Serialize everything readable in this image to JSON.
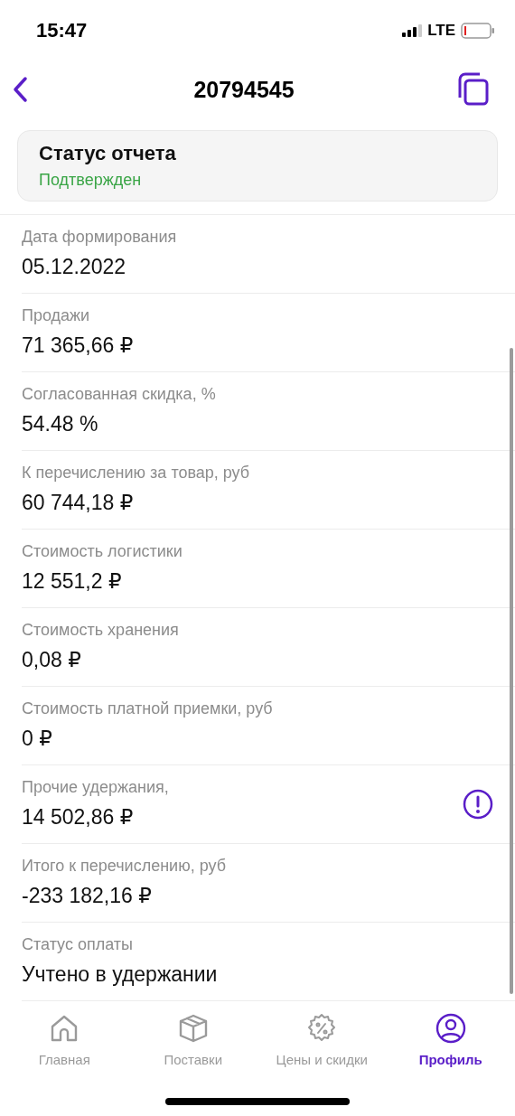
{
  "status_bar": {
    "time": "15:47",
    "network": "LTE"
  },
  "header": {
    "title": "20794545"
  },
  "status_card": {
    "title": "Статус отчета",
    "value": "Подтвержден"
  },
  "rows": [
    {
      "label": "Дата формирования",
      "value": "05.12.2022",
      "alert": false
    },
    {
      "label": "Продажи",
      "value": "71 365,66 ₽",
      "alert": false
    },
    {
      "label": "Согласованная скидка, %",
      "value": "54.48 %",
      "alert": false
    },
    {
      "label": "К перечислению за товар, руб",
      "value": "60 744,18 ₽",
      "alert": false
    },
    {
      "label": "Стоимость логистики",
      "value": "12 551,2 ₽",
      "alert": false
    },
    {
      "label": "Стоимость хранения",
      "value": "0,08 ₽",
      "alert": false
    },
    {
      "label": "Стоимость платной приемки, руб",
      "value": "0 ₽",
      "alert": false
    },
    {
      "label": "Прочие удержания,",
      "value": "14 502,86 ₽",
      "alert": true
    },
    {
      "label": "Итого к перечислению, руб",
      "value": "-233 182,16 ₽",
      "alert": false
    },
    {
      "label": "Статус оплаты",
      "value": "Учтено в удержании",
      "alert": false
    }
  ],
  "tabs": [
    {
      "label": "Главная",
      "selected": false
    },
    {
      "label": "Поставки",
      "selected": false
    },
    {
      "label": "Цены и скидки",
      "selected": false
    },
    {
      "label": "Профиль",
      "selected": true
    }
  ]
}
